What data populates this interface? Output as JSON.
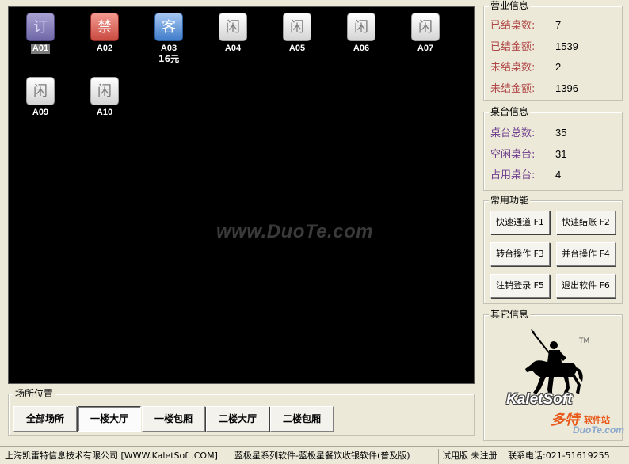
{
  "tables": [
    {
      "id": "A01",
      "status_char": "订",
      "status": "reserved",
      "selected": true,
      "amount": ""
    },
    {
      "id": "A02",
      "status_char": "禁",
      "status": "banned",
      "selected": false,
      "amount": ""
    },
    {
      "id": "A03",
      "status_char": "客",
      "status": "occupied",
      "selected": false,
      "amount": "16元"
    },
    {
      "id": "A04",
      "status_char": "闲",
      "status": "idle",
      "selected": false,
      "amount": ""
    },
    {
      "id": "A05",
      "status_char": "闲",
      "status": "idle",
      "selected": false,
      "amount": ""
    },
    {
      "id": "A06",
      "status_char": "闲",
      "status": "idle",
      "selected": false,
      "amount": ""
    },
    {
      "id": "A07",
      "status_char": "闲",
      "status": "idle",
      "selected": false,
      "amount": ""
    },
    {
      "id": "A09",
      "status_char": "闲",
      "status": "idle",
      "selected": false,
      "amount": ""
    },
    {
      "id": "A10",
      "status_char": "闲",
      "status": "idle",
      "selected": false,
      "amount": ""
    }
  ],
  "watermark": "www.DuoTe.com",
  "location": {
    "title": "场所位置",
    "buttons": [
      "全部场所",
      "一楼大厅",
      "一楼包厢",
      "二楼大厅",
      "二楼包厢"
    ],
    "active_index": 1
  },
  "business_info": {
    "title": "营业信息",
    "rows": [
      {
        "label": "已结桌数:",
        "value": "7"
      },
      {
        "label": "已结金额:",
        "value": "1539"
      },
      {
        "label": "未结桌数:",
        "value": "2"
      },
      {
        "label": "未结金额:",
        "value": "1396"
      }
    ]
  },
  "table_info": {
    "title": "桌台信息",
    "rows": [
      {
        "label": "桌台总数:",
        "value": "35"
      },
      {
        "label": "空闲桌台:",
        "value": "31"
      },
      {
        "label": "占用桌台:",
        "value": "4"
      }
    ]
  },
  "functions": {
    "title": "常用功能",
    "buttons": [
      "快速通道 F1",
      "快速结账 F2",
      "转台操作 F3",
      "并台操作 F4",
      "注销登录 F5",
      "退出软件 F6"
    ]
  },
  "other_info": {
    "title": "其它信息",
    "logo_text": "KaletSoft",
    "tm": "TM",
    "site_watermark": "多特",
    "site_watermark_sub": "软件站",
    "site_url_watermark": "DuoTe.com"
  },
  "status_bar": [
    "上海凯雷特信息技术有限公司 [WWW.KaletSoft.COM]",
    "蓝极星系列软件-蓝极星餐饮收银软件(普及版)",
    "试用版 未注册",
    "联系电话:021-51619255"
  ],
  "colors": {
    "reserved": "#6e67a8",
    "banned": "#c94a40",
    "occupied": "#3f7cc9",
    "idle": "#e6e6e6",
    "business_label": "#b04848",
    "table_label": "#6e3c8e"
  }
}
